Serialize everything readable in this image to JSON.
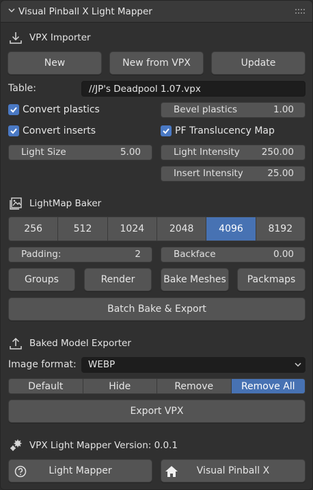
{
  "header": {
    "title": "Visual Pinball X Light Mapper"
  },
  "importer": {
    "title": "VPX Importer",
    "new_label": "New",
    "new_from_vpx_label": "New from VPX",
    "update_label": "Update",
    "table_label": "Table:",
    "table_value": "//JP's Deadpool 1.07.vpx",
    "convert_plastics_label": "Convert plastics",
    "convert_plastics_checked": true,
    "convert_inserts_label": "Convert inserts",
    "convert_inserts_checked": true,
    "bevel_plastics_label": "Bevel plastics",
    "bevel_plastics_value": "1.00",
    "pf_translucency_label": "PF Translucency Map",
    "pf_translucency_checked": true,
    "light_size_label": "Light Size",
    "light_size_value": "5.00",
    "light_intensity_label": "Light Intensity",
    "light_intensity_value": "250.00",
    "insert_intensity_label": "Insert Intensity",
    "insert_intensity_value": "25.00"
  },
  "baker": {
    "title": "LightMap Baker",
    "resolutions": [
      "256",
      "512",
      "1024",
      "2048",
      "4096",
      "8192"
    ],
    "selected_resolution": "4096",
    "padding_label": "Padding:",
    "padding_value": "2",
    "backface_label": "Backface",
    "backface_value": "0.00",
    "groups_label": "Groups",
    "render_label": "Render",
    "bake_meshes_label": "Bake Meshes",
    "packmaps_label": "Packmaps",
    "batch_label": "Batch Bake & Export"
  },
  "exporter": {
    "title": "Baked Model Exporter",
    "image_format_label": "Image format:",
    "image_format_value": "WEBP",
    "modes": [
      "Default",
      "Hide",
      "Remove",
      "Remove All"
    ],
    "selected_mode": "Remove All",
    "export_label": "Export VPX"
  },
  "footer": {
    "version_label": "VPX Light Mapper Version: 0.0.1",
    "light_mapper_label": "Light Mapper",
    "visual_pinball_label": "Visual Pinball X"
  },
  "colors": {
    "accent": "#4772b3",
    "checkbox": "#4a79c4",
    "panel_bg": "#303030",
    "button_bg": "#545454",
    "field_bg": "#1d1d1d"
  },
  "icons": [
    "chevron-down-icon",
    "drag-grip-icon",
    "import-icon",
    "image-icon",
    "export-icon",
    "gear-icon",
    "help-icon",
    "home-icon",
    "dropdown-arrow-icon",
    "checkmark-icon"
  ]
}
